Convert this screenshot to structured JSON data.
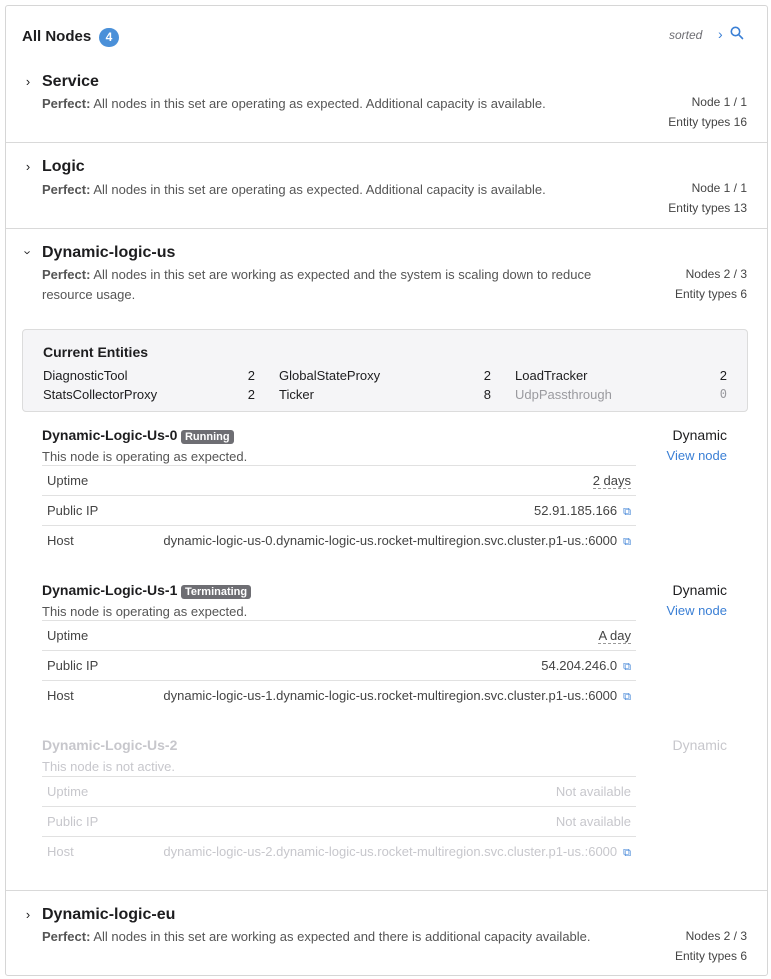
{
  "header": {
    "title": "All Nodes",
    "count": "4",
    "sorted_label": "sorted",
    "chevron_icon": "chevron-right-icon",
    "search_icon": "search-icon"
  },
  "sets": [
    {
      "name": "Service",
      "status_label": "Perfect:",
      "description": "All nodes in this set are operating as expected. Additional capacity is available.",
      "nodes": "Node 1 / 1",
      "entity_types": "Entity types 16"
    },
    {
      "name": "Logic",
      "status_label": "Perfect:",
      "description": "All nodes in this set are operating as expected. Additional capacity is available.",
      "nodes": "Node 1 / 1",
      "entity_types": "Entity types 13"
    },
    {
      "name": "Dynamic-logic-us",
      "status_label": "Perfect:",
      "description": "All nodes in this set are working as expected and the system is scaling down to reduce resource usage.",
      "nodes": "Nodes 2 / 3",
      "entity_types": "Entity types 6"
    },
    {
      "name": "Dynamic-logic-eu",
      "status_label": "Perfect:",
      "description": "All nodes in this set are working as expected and there is additional capacity available.",
      "nodes": "Nodes 2 / 3",
      "entity_types": "Entity types 6"
    }
  ],
  "entities": {
    "title": "Current Entities",
    "items": [
      {
        "name": "DiagnosticTool",
        "value": "2"
      },
      {
        "name": "GlobalStateProxy",
        "value": "2"
      },
      {
        "name": "LoadTracker",
        "value": "2"
      },
      {
        "name": "StatsCollectorProxy",
        "value": "2"
      },
      {
        "name": "Ticker",
        "value": "8"
      },
      {
        "name": "UdpPassthrough",
        "value": "0"
      }
    ]
  },
  "nodes": [
    {
      "name": "Dynamic-Logic-Us-0",
      "badge": "Running",
      "subtitle": "This node is operating as expected.",
      "type": "Dynamic",
      "view_link": "View node",
      "uptime_label": "Uptime",
      "uptime": "2 days",
      "ip_label": "Public IP",
      "ip": "52.91.185.166",
      "host_label": "Host",
      "host": "dynamic-logic-us-0.dynamic-logic-us.rocket-multiregion.svc.cluster.p1-us.:6000"
    },
    {
      "name": "Dynamic-Logic-Us-1",
      "badge": "Terminating",
      "subtitle": "This node is operating as expected.",
      "type": "Dynamic",
      "view_link": "View node",
      "uptime_label": "Uptime",
      "uptime": "A day",
      "ip_label": "Public IP",
      "ip": "54.204.246.0",
      "host_label": "Host",
      "host": "dynamic-logic-us-1.dynamic-logic-us.rocket-multiregion.svc.cluster.p1-us.:6000"
    },
    {
      "name": "Dynamic-Logic-Us-2",
      "subtitle": "This node is not active.",
      "type": "Dynamic",
      "uptime_label": "Uptime",
      "uptime": "Not available",
      "ip_label": "Public IP",
      "ip": "Not available",
      "host_label": "Host",
      "host": "dynamic-logic-us-2.dynamic-logic-us.rocket-multiregion.svc.cluster.p1-us.:6000"
    }
  ],
  "colors": {
    "accent": "#3a7fd5",
    "badge": "#6e6e73",
    "count_badge": "#4a90d9",
    "inactive_text": "#c7c7cc"
  }
}
